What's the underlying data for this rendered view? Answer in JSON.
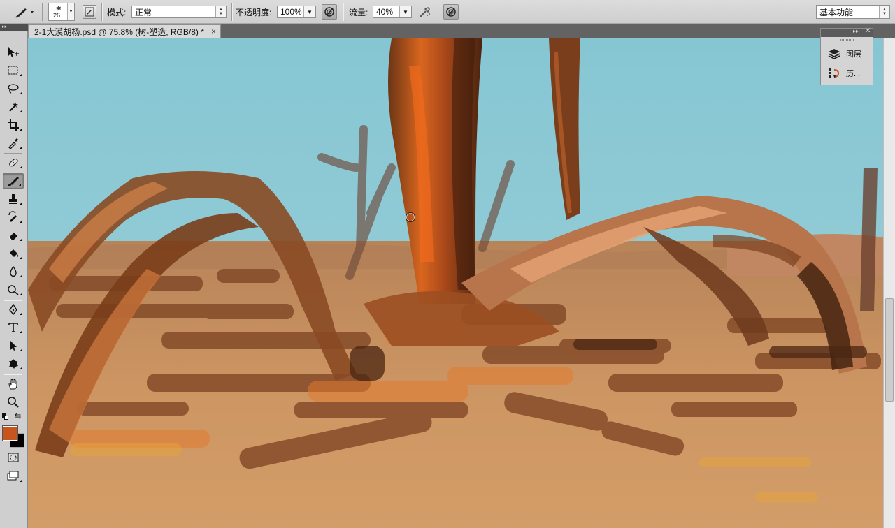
{
  "options_bar": {
    "brush_size": "26",
    "mode_label": "模式:",
    "mode_value": "正常",
    "opacity_label": "不透明度:",
    "opacity_value": "100%",
    "flow_label": "流量:",
    "flow_value": "40%",
    "workspace_value": "基本功能"
  },
  "document_tab": {
    "title": "2-1大漠胡杨.psd @ 75.8% (树-塑造, RGB/8) *",
    "close": "×"
  },
  "panel": {
    "items": [
      {
        "label": "图层",
        "icon": "layers-icon"
      },
      {
        "label": "历...",
        "icon": "history-icon"
      }
    ]
  },
  "toolbar": {
    "active_tool": "brush-tool",
    "foreground_color": "#c8541e",
    "background_color": "#000000",
    "tools": [
      "move-tool",
      "marquee-tool",
      "lasso-tool",
      "magic-wand-tool",
      "crop-tool",
      "eyedropper-tool",
      "healing-brush-tool",
      "brush-tool",
      "clone-stamp-tool",
      "history-brush-tool",
      "eraser-tool",
      "paint-bucket-tool",
      "blur-tool",
      "dodge-tool",
      "pen-tool",
      "type-tool",
      "path-selection-tool",
      "custom-shape-tool",
      "hand-tool",
      "zoom-tool"
    ]
  },
  "colors": {
    "sky": "#8ec9d4",
    "sand": "#c9925f",
    "trunk": "#7a3d1a",
    "highlight": "#e07a2a"
  }
}
